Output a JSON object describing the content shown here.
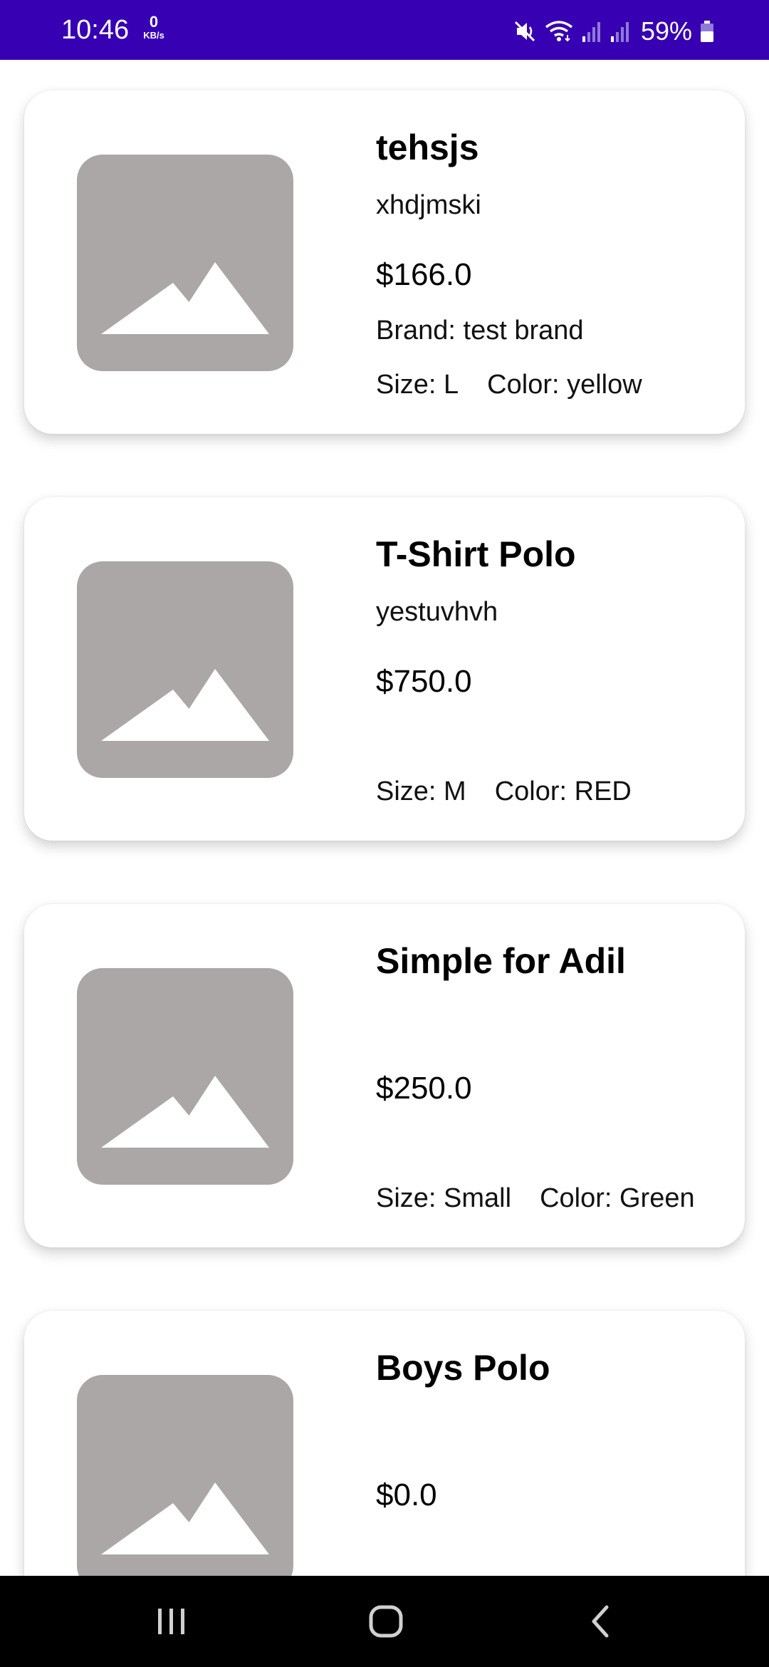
{
  "status_bar": {
    "time": "10:46",
    "net_speed_value": "0",
    "net_speed_unit": "KB/s",
    "battery_percent": "59%",
    "icons": [
      "mute-icon",
      "wifi-icon",
      "signal-icon",
      "signal-icon",
      "battery-icon"
    ],
    "background_color": "#3700b3"
  },
  "products": [
    {
      "name": "tehsjs",
      "description": "xhdjmski",
      "price": "$166.0",
      "brand": "Brand: test brand",
      "size": "Size: L",
      "color": "Color: yellow"
    },
    {
      "name": "T-Shirt Polo",
      "description": "yestuvhvh",
      "price": "$750.0",
      "brand": "",
      "size": "Size: M",
      "color": "Color: RED"
    },
    {
      "name": "Simple for Adil",
      "description": "",
      "price": "$250.0",
      "brand": "",
      "size": "Size: Small",
      "color": "Color: Green"
    },
    {
      "name": "Boys Polo",
      "description": "",
      "price": "$0.0",
      "brand": "",
      "size": "",
      "color": ""
    }
  ],
  "image_placeholder_icon": "image-placeholder-icon",
  "nav_bar": {
    "icons": [
      "recent-apps-icon",
      "home-icon",
      "back-icon"
    ]
  }
}
